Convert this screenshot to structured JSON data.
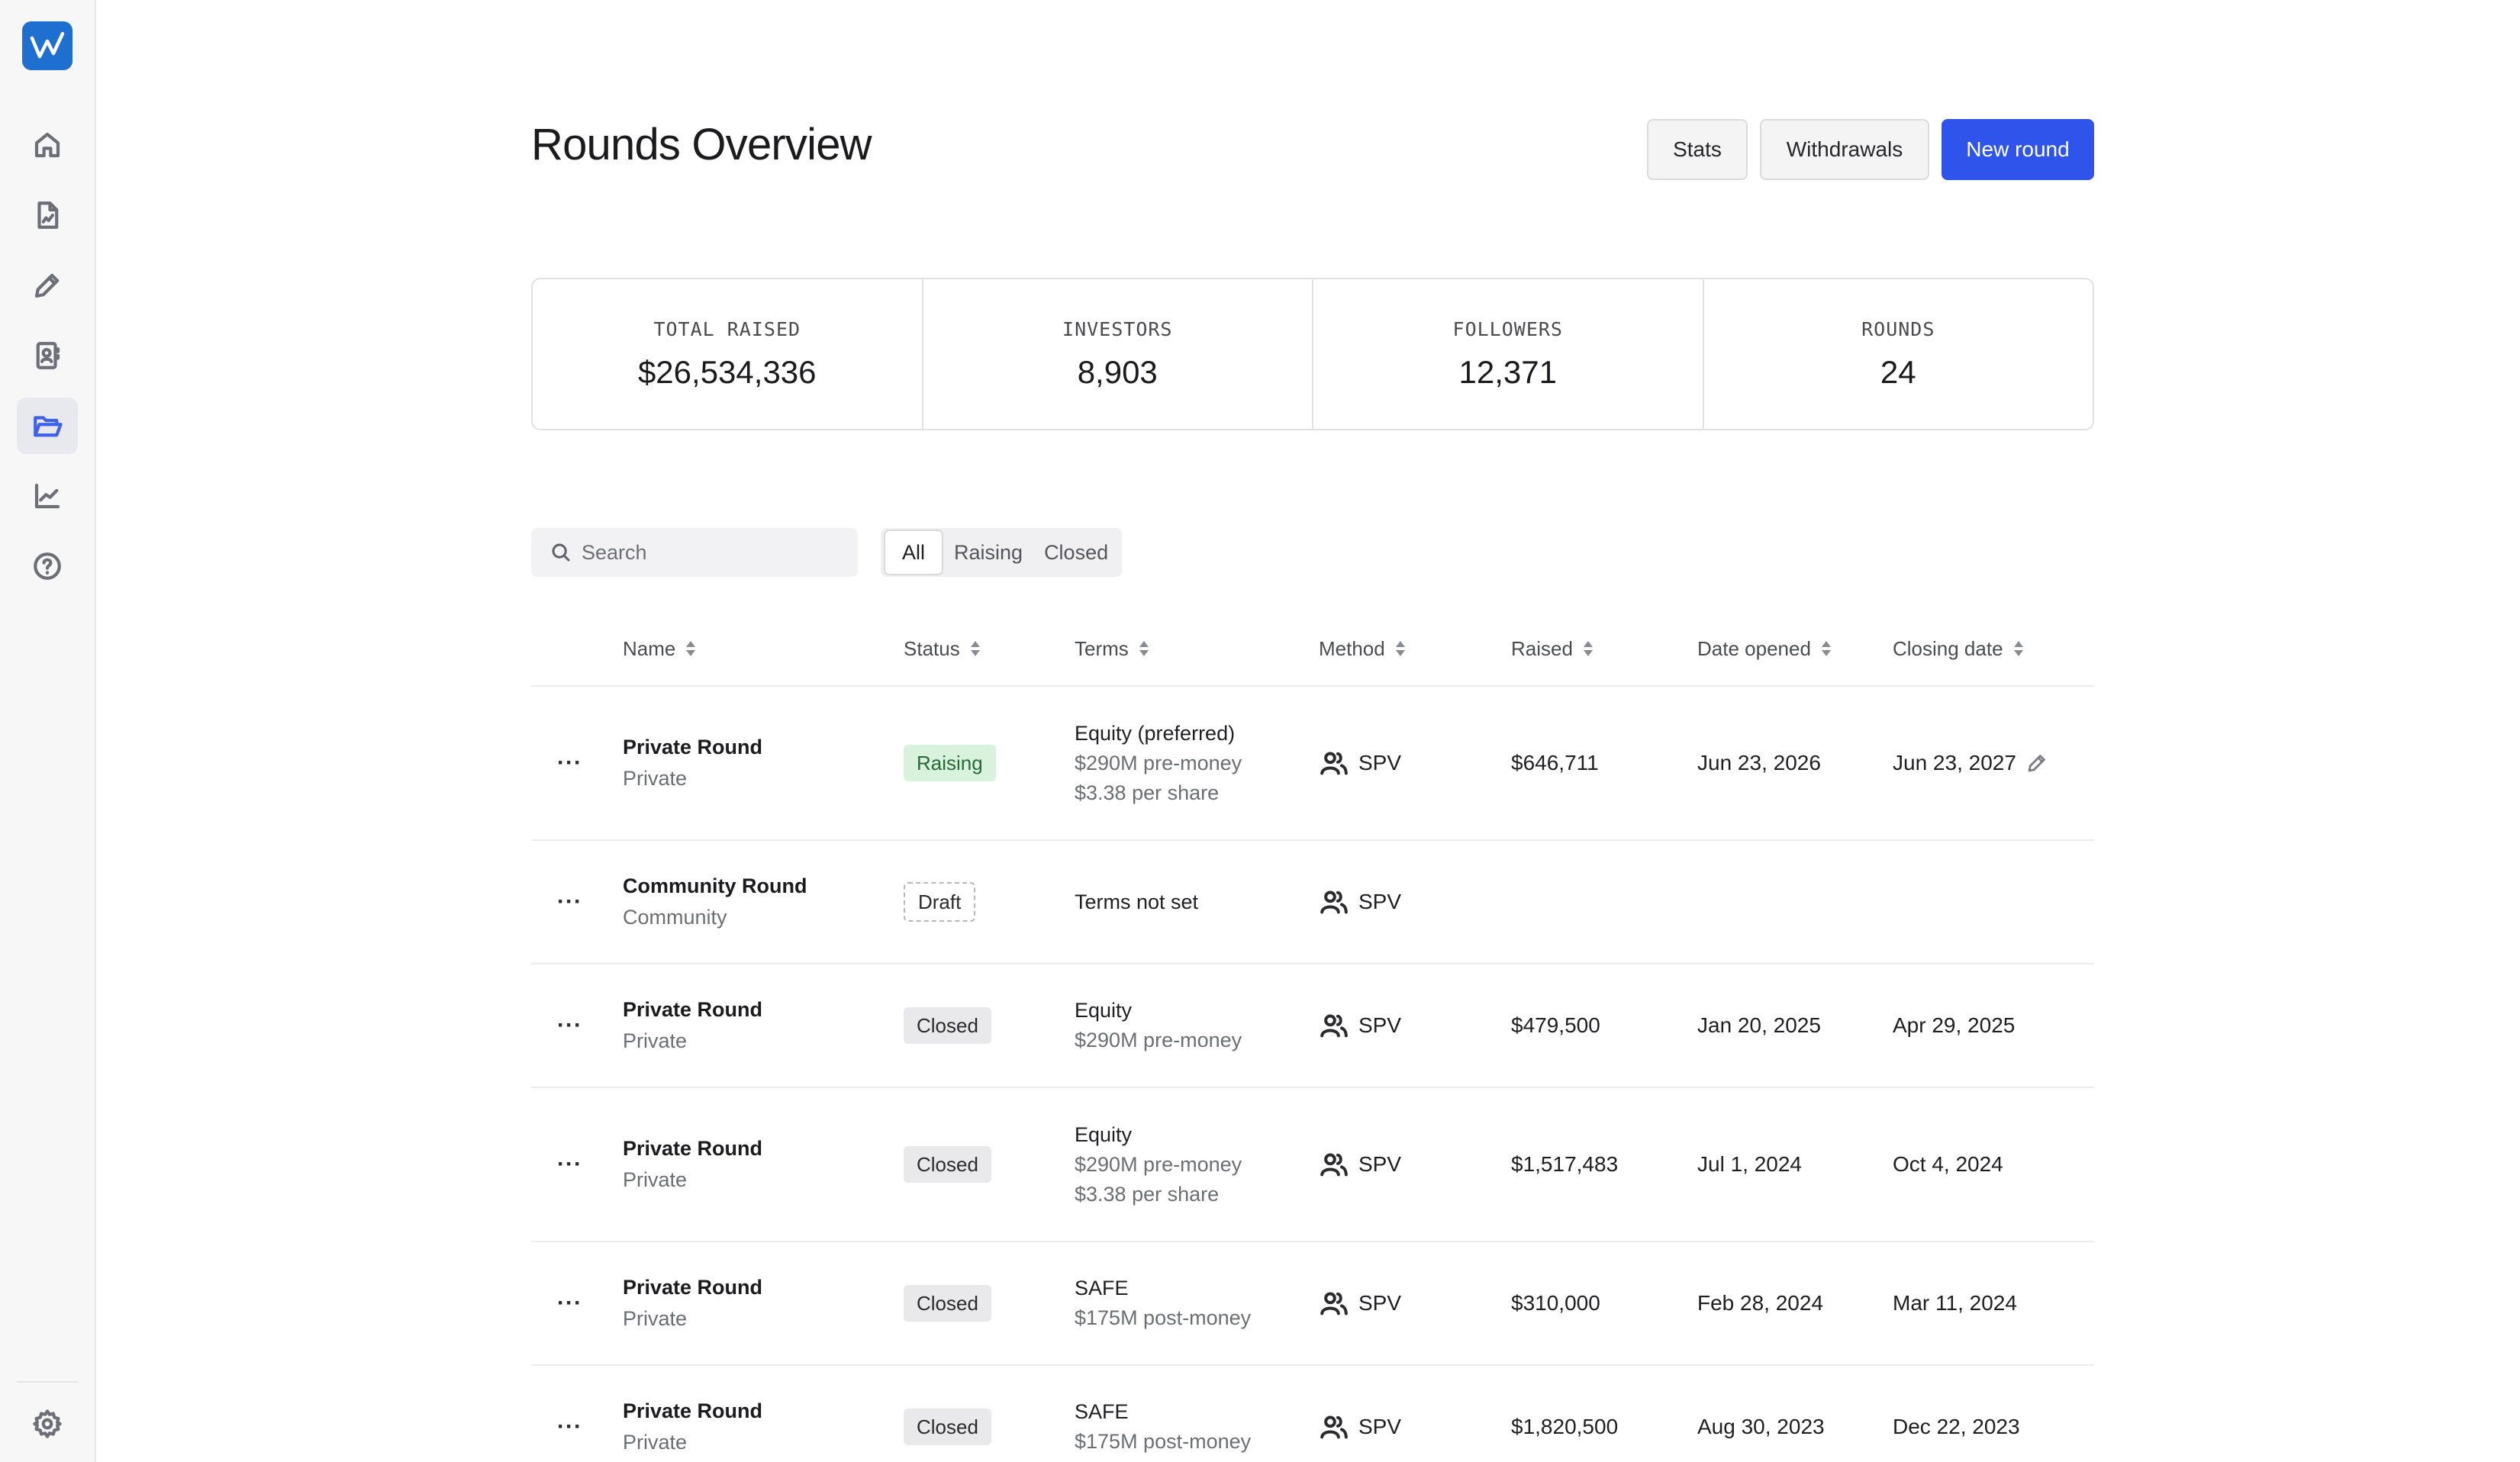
{
  "header": {
    "title": "Rounds Overview",
    "stats_button": "Stats",
    "withdrawals_button": "Withdrawals",
    "new_round_button": "New round"
  },
  "stats": [
    {
      "label": "TOTAL RAISED",
      "value": "$26,534,336"
    },
    {
      "label": "INVESTORS",
      "value": "8,903"
    },
    {
      "label": "FOLLOWERS",
      "value": "12,371"
    },
    {
      "label": "ROUNDS",
      "value": "24"
    }
  ],
  "search": {
    "placeholder": "Search",
    "value": ""
  },
  "filters": {
    "all": "All",
    "raising": "Raising",
    "closed": "Closed",
    "selected": "All"
  },
  "sidebar": {
    "logo": "logo-icon",
    "items": [
      {
        "icon": "home-icon",
        "active": false
      },
      {
        "icon": "document-chart-icon",
        "active": false
      },
      {
        "icon": "pencil-icon",
        "active": false
      },
      {
        "icon": "contacts-icon",
        "active": false
      },
      {
        "icon": "folder-open-icon",
        "active": true
      },
      {
        "icon": "line-chart-icon",
        "active": false
      },
      {
        "icon": "help-icon",
        "active": false
      }
    ],
    "settings": "gear-icon"
  },
  "colors": {
    "accent": "#2f54eb",
    "raising_bg": "#d9f2de",
    "raising_text": "#256b37"
  },
  "table": {
    "columns": [
      "Name",
      "Status",
      "Terms",
      "Method",
      "Raised",
      "Date opened",
      "Closing date"
    ],
    "rows": [
      {
        "menu": "···",
        "name": "Private Round",
        "type": "Private",
        "status": "Raising",
        "terms": [
          "Equity (preferred)",
          "$290M pre-money",
          "$3.38 per share"
        ],
        "method": "SPV",
        "raised": "$646,711",
        "opened": "Jun 23, 2026",
        "closing": "Jun 23, 2027"
      },
      {
        "menu": "···",
        "name": "Community Round",
        "type": "Community",
        "status": "Draft",
        "terms": [
          "Terms not set"
        ],
        "method": "SPV",
        "raised": "",
        "opened": "",
        "closing": ""
      },
      {
        "menu": "···",
        "name": "Private Round",
        "type": "Private",
        "status": "Closed",
        "terms": [
          "Equity",
          "$290M pre-money"
        ],
        "method": "SPV",
        "raised": "$479,500",
        "opened": "Jan 20, 2025",
        "closing": "Apr 29, 2025"
      },
      {
        "menu": "···",
        "name": "Private Round",
        "type": "Private",
        "status": "Closed",
        "terms": [
          "Equity",
          "$290M pre-money",
          "$3.38 per share"
        ],
        "method": "SPV",
        "raised": "$1,517,483",
        "opened": "Jul 1, 2024",
        "closing": "Oct 4, 2024"
      },
      {
        "menu": "···",
        "name": "Private Round",
        "type": "Private",
        "status": "Closed",
        "terms": [
          "SAFE",
          "$175M post-money"
        ],
        "method": "SPV",
        "raised": "$310,000",
        "opened": "Feb 28, 2024",
        "closing": "Mar 11, 2024"
      },
      {
        "menu": "···",
        "name": "Private Round",
        "type": "Private",
        "status": "Closed",
        "terms": [
          "SAFE",
          "$175M post-money"
        ],
        "method": "SPV",
        "raised": "$1,820,500",
        "opened": "Aug 30, 2023",
        "closing": "Dec 22, 2023"
      }
    ]
  }
}
